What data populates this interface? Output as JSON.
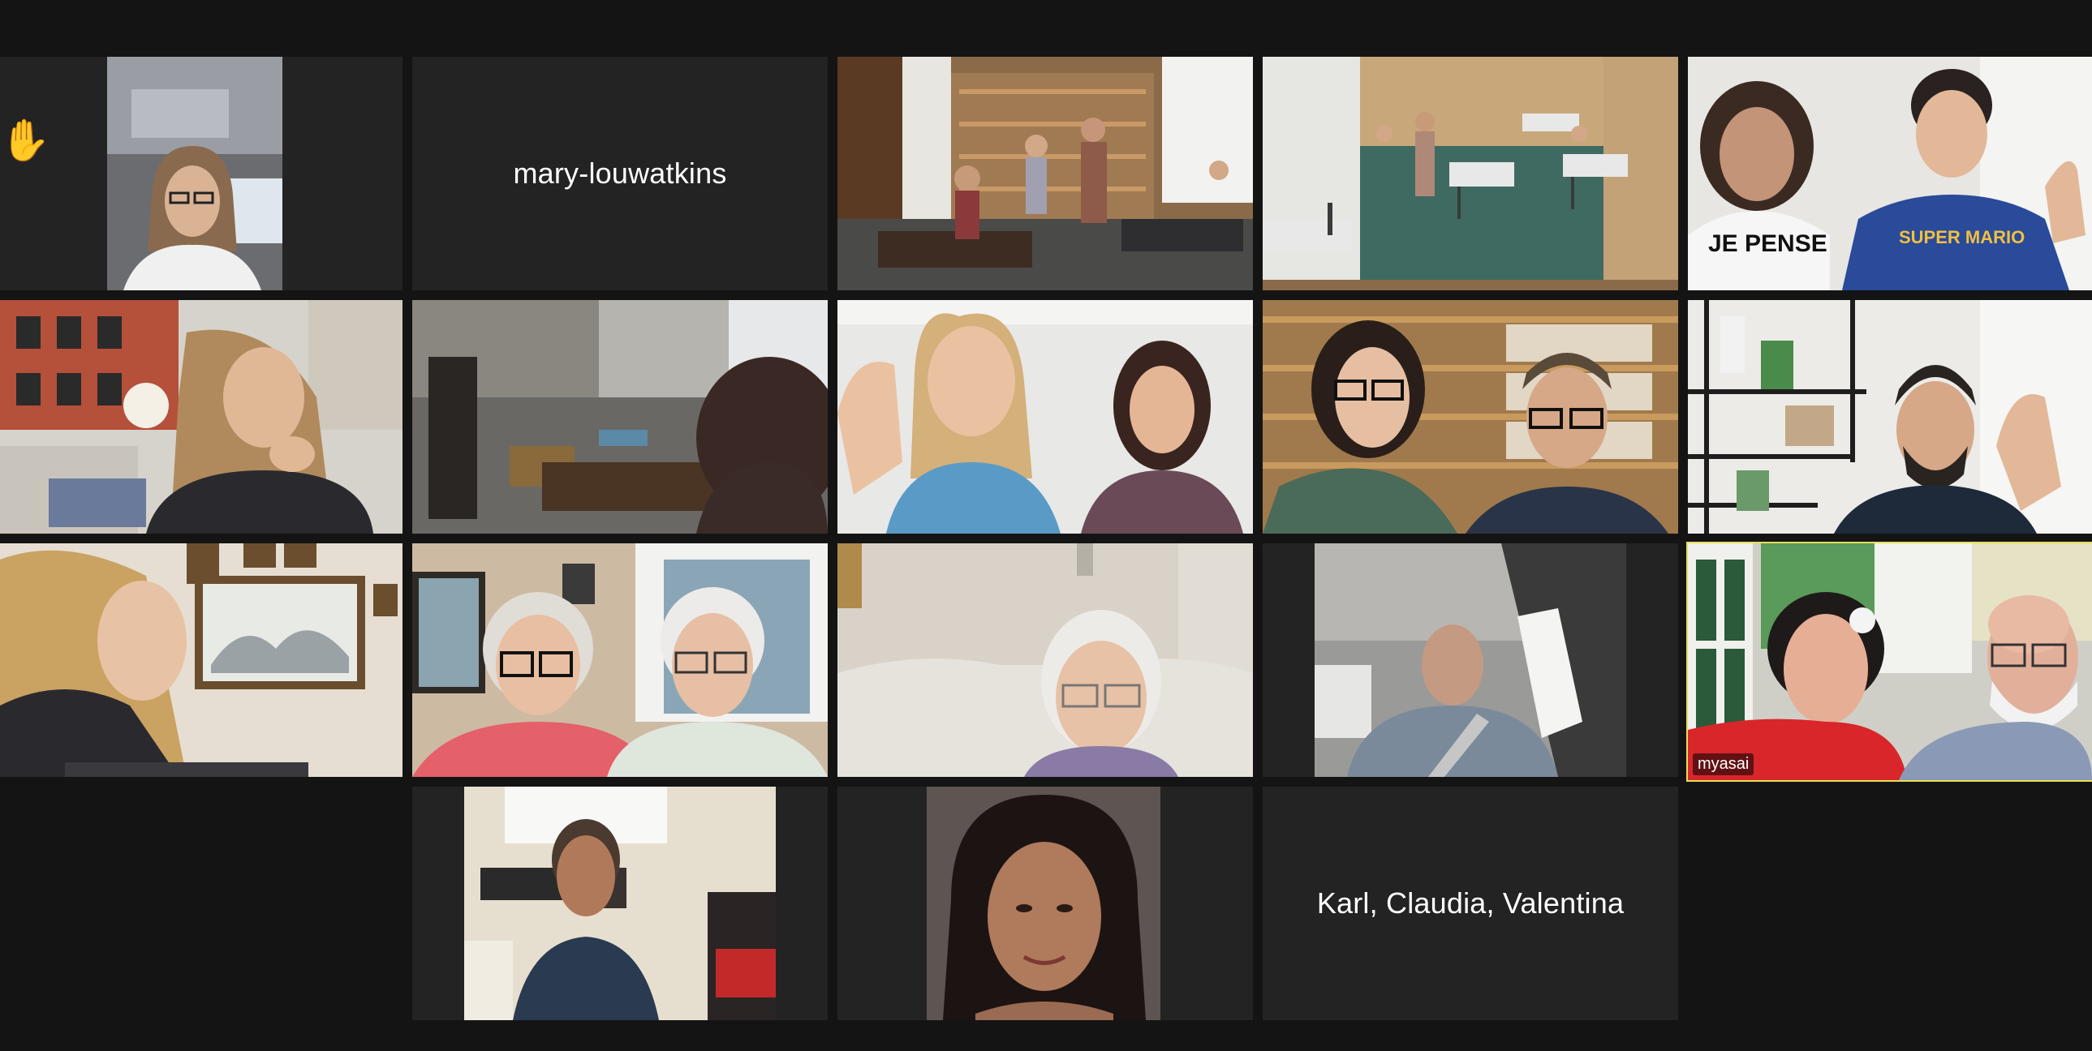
{
  "participants": {
    "t01": {
      "video_label": "Participant in car wearing glasses",
      "raised_hand": "✋"
    },
    "t02": {
      "display_name": "mary-louwatkins"
    },
    "t03": {
      "video_label": "Classroom with students"
    },
    "t04": {
      "video_label": "Classroom with students and desks"
    },
    "t05": {
      "video_label": "Woman and child waving"
    },
    "t06": {
      "video_label": "Woman with hand on chin"
    },
    "t07": {
      "video_label": "Person seen from behind in room"
    },
    "t08": {
      "video_label": "Woman waving with teen girl"
    },
    "t09": {
      "video_label": "Couple with glasses in front of bookshelves"
    },
    "t10": {
      "video_label": "Man waving near shelves"
    },
    "t11": {
      "video_label": "Woman with long hair smiling"
    },
    "t12": {
      "video_label": "Older couple with glasses"
    },
    "t13": {
      "video_label": "Older woman on sofa"
    },
    "t14": {
      "video_label": "Man in car"
    },
    "t15": {
      "video_label": "Couple smiling",
      "name_tag": "myasai"
    },
    "t16": {
      "video_label": "Man smiling in office"
    },
    "t17": {
      "video_label": "Portrait of woman"
    },
    "t18": {
      "display_name": "Karl, Claudia, Valentina"
    }
  },
  "colors": {
    "background": "#141414",
    "tile": "#232323",
    "active_speaker_border": "#e6e05a"
  }
}
